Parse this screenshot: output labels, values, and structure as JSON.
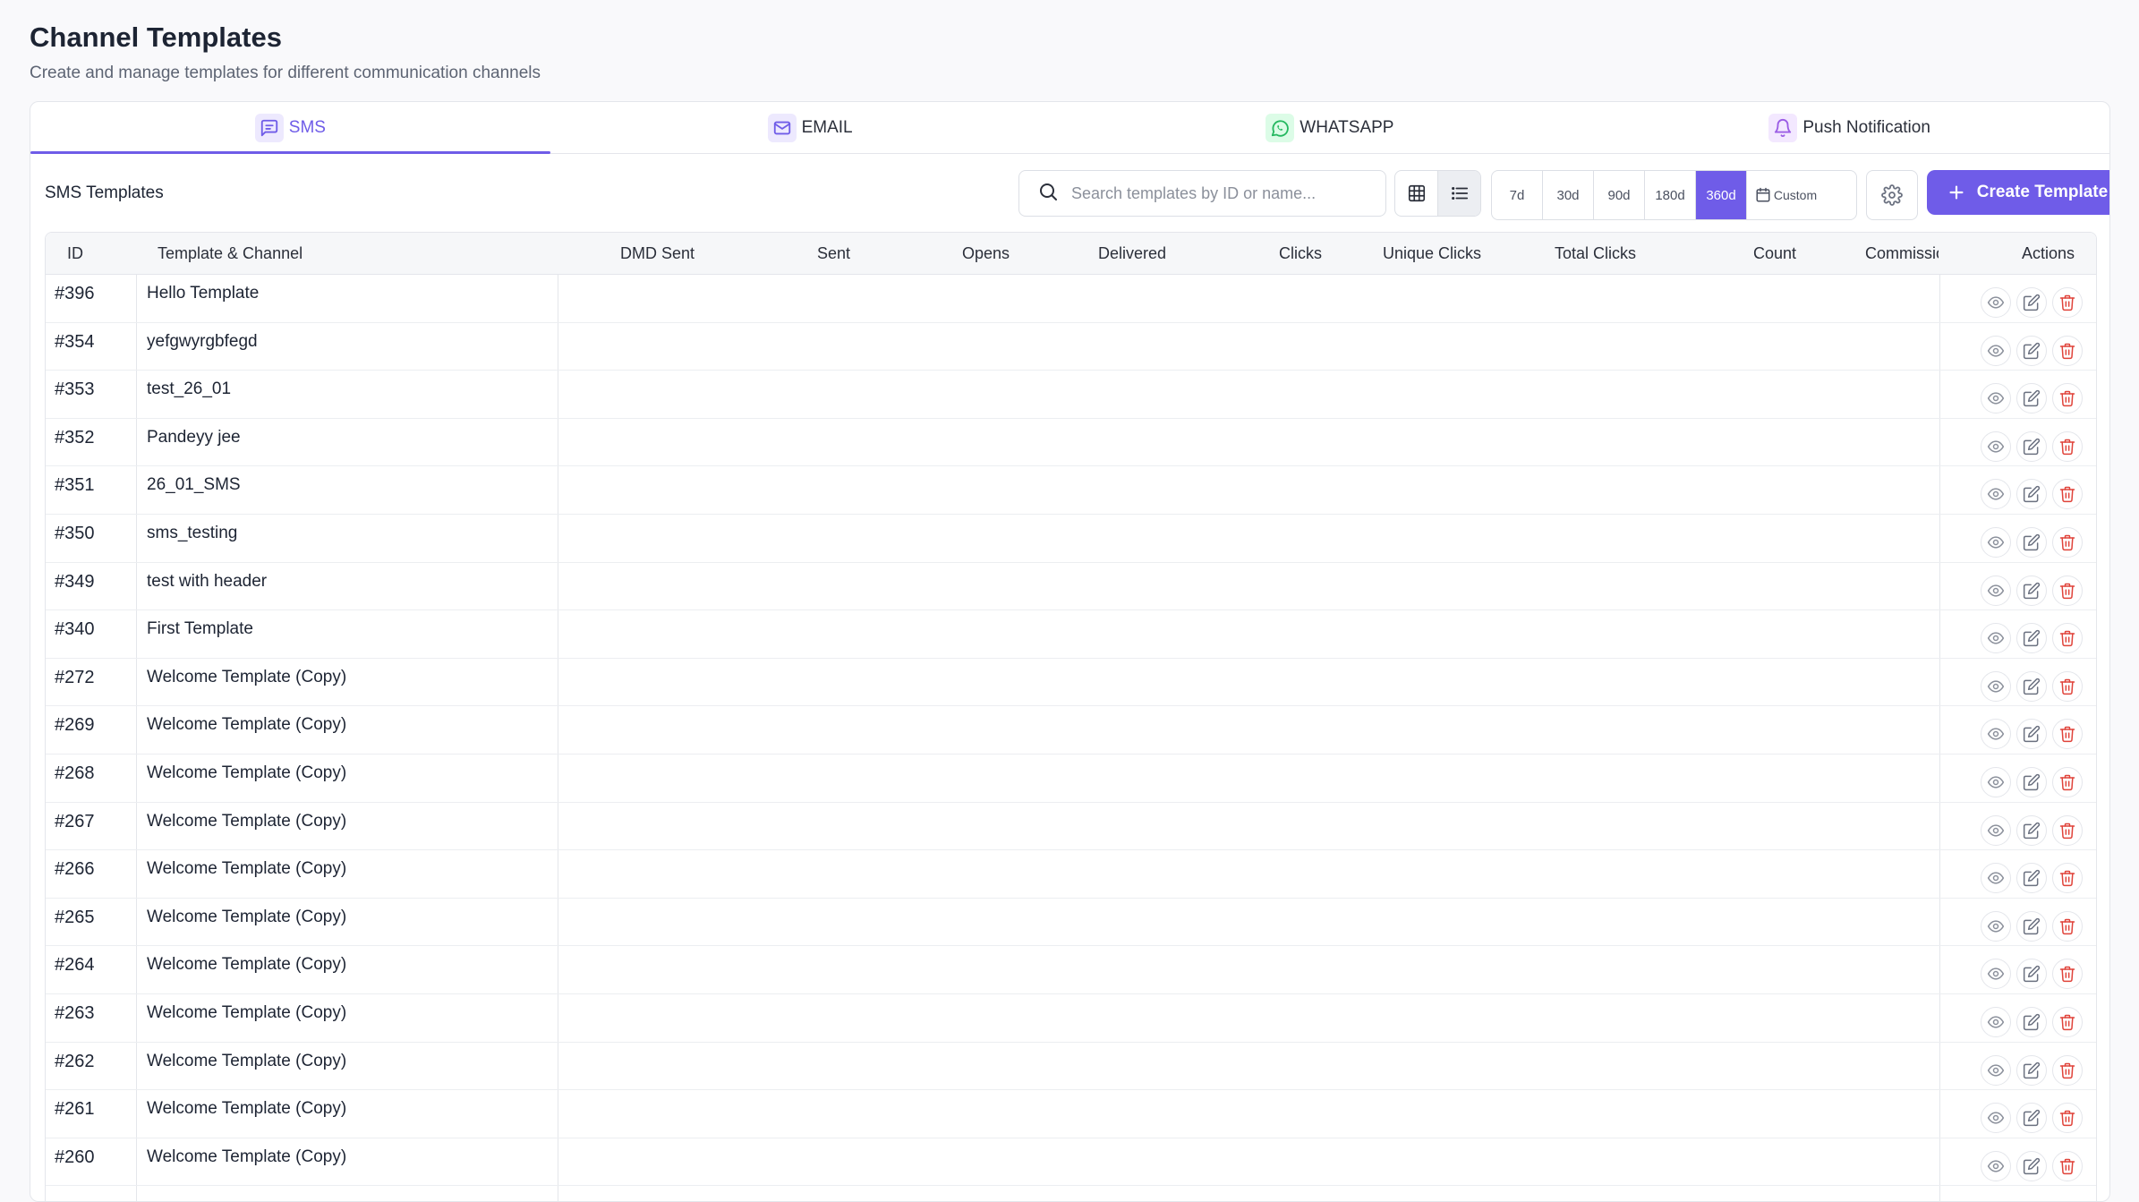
{
  "header": {
    "title": "Channel Templates",
    "subtitle": "Create and manage templates for different communication channels"
  },
  "tabs": [
    {
      "label": "SMS",
      "icon": "message-square-icon",
      "active": true
    },
    {
      "label": "EMAIL",
      "icon": "mail-icon",
      "active": false
    },
    {
      "label": "WHATSAPP",
      "icon": "whatsapp-icon",
      "active": false
    },
    {
      "label": "Push Notification",
      "icon": "bell-icon",
      "active": false
    }
  ],
  "toolbar": {
    "section_title": "SMS Templates",
    "search_placeholder": "Search templates by ID or name...",
    "search_value": "",
    "ranges": [
      "7d",
      "30d",
      "90d",
      "180d",
      "360d"
    ],
    "active_range": "360d",
    "custom_label": "Custom",
    "create_label": "Create Template"
  },
  "table": {
    "headers": {
      "id": "ID",
      "template": "Template & Channel",
      "dmd_sent": "DMD Sent",
      "sent": "Sent",
      "opens": "Opens",
      "delivered": "Delivered",
      "clicks": "Clicks",
      "unique_clicks": "Unique Clicks",
      "total_clicks": "Total Clicks",
      "count": "Count",
      "commission": "Commission",
      "actions": "Actions"
    },
    "rows": [
      {
        "id": "#396",
        "name": "Hello Template"
      },
      {
        "id": "#354",
        "name": "yefgwyrgbfegd"
      },
      {
        "id": "#353",
        "name": "test_26_01"
      },
      {
        "id": "#352",
        "name": "Pandeyy jee"
      },
      {
        "id": "#351",
        "name": "26_01_SMS"
      },
      {
        "id": "#350",
        "name": "sms_testing"
      },
      {
        "id": "#349",
        "name": "test with header"
      },
      {
        "id": "#340",
        "name": "First Template"
      },
      {
        "id": "#272",
        "name": "Welcome Template (Copy)"
      },
      {
        "id": "#269",
        "name": "Welcome Template (Copy)"
      },
      {
        "id": "#268",
        "name": "Welcome Template (Copy)"
      },
      {
        "id": "#267",
        "name": "Welcome Template (Copy)"
      },
      {
        "id": "#266",
        "name": "Welcome Template (Copy)"
      },
      {
        "id": "#265",
        "name": "Welcome Template (Copy)"
      },
      {
        "id": "#264",
        "name": "Welcome Template (Copy)"
      },
      {
        "id": "#263",
        "name": "Welcome Template (Copy)"
      },
      {
        "id": "#262",
        "name": "Welcome Template (Copy)"
      },
      {
        "id": "#261",
        "name": "Welcome Template (Copy)"
      },
      {
        "id": "#260",
        "name": "Welcome Template (Copy)"
      }
    ]
  },
  "colors": {
    "accent": "#6f5ce8",
    "danger": "#e0433a",
    "whatsapp": "#25b860"
  }
}
